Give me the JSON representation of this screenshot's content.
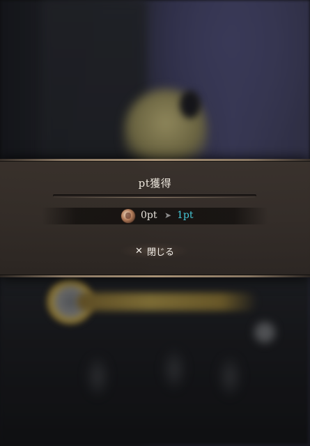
{
  "dialog": {
    "title": "pt獲得",
    "points": {
      "from": "0pt",
      "arrow_icon": "chevron-right-icon",
      "to": "1pt"
    },
    "close_button": {
      "icon": "close-icon",
      "label": "閉じる"
    }
  },
  "colors": {
    "gained_points": "#46c8d8",
    "text": "#ece6dc",
    "panel": "#3a322c"
  }
}
